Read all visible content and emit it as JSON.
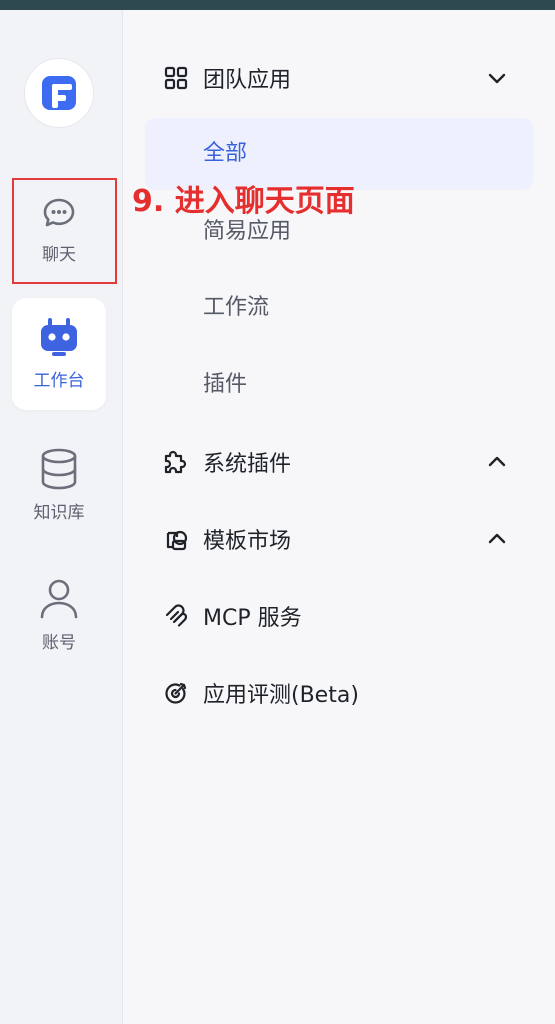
{
  "nav": {
    "items": [
      {
        "label": "聊天"
      },
      {
        "label": "工作台"
      },
      {
        "label": "知识库"
      },
      {
        "label": "账号"
      }
    ]
  },
  "annotation": {
    "text": "9. 进入聊天页面"
  },
  "menu": {
    "team_apps": {
      "label": "团队应用",
      "children": [
        "全部",
        "简易应用",
        "工作流",
        "插件"
      ]
    },
    "system_plugins": {
      "label": "系统插件"
    },
    "template_market": {
      "label": "模板市场"
    },
    "mcp": {
      "label": "MCP 服务"
    },
    "app_eval": {
      "label": "应用评测(Beta)"
    }
  },
  "colors": {
    "accent": "#3b63d9",
    "annotation": "#e52e2e",
    "active_bg": "#eef1fd"
  }
}
